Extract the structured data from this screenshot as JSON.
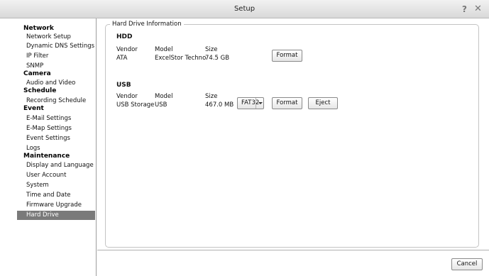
{
  "window": {
    "title": "Setup",
    "help_icon": "?",
    "close_icon": "✕"
  },
  "sidebar": {
    "categories": [
      {
        "label": "Network",
        "items": [
          "Network Setup",
          "Dynamic DNS Settings",
          "IP Filter",
          "SNMP"
        ]
      },
      {
        "label": "Camera",
        "items": [
          "Audio and Video"
        ]
      },
      {
        "label": "Schedule",
        "items": [
          "Recording Schedule"
        ]
      },
      {
        "label": "Event",
        "items": [
          "E-Mail Settings",
          "E-Map Settings",
          "Event Settings",
          "Logs"
        ]
      },
      {
        "label": "Maintenance",
        "items": [
          "Display and Language",
          "User Account",
          "System",
          "Time and Date",
          "Firmware Upgrade",
          "Hard Drive"
        ]
      }
    ],
    "active_item": "Hard Drive"
  },
  "panel": {
    "legend": "Hard Drive Information",
    "hdd": {
      "heading": "HDD",
      "col_vendor": "Vendor",
      "col_model": "Model",
      "col_size": "Size",
      "vendor": "ATA",
      "model": "ExcelStor Techno",
      "size": "74.5 GB",
      "format_label": "Format"
    },
    "usb": {
      "heading": "USB",
      "col_vendor": "Vendor",
      "col_model": "Model",
      "col_size": "Size",
      "vendor": "USB Storage",
      "model": "USB",
      "size": "467.0 MB",
      "filesystem": "FAT32",
      "format_label": "Format",
      "eject_label": "Eject"
    }
  },
  "footer": {
    "cancel_label": "Cancel"
  }
}
